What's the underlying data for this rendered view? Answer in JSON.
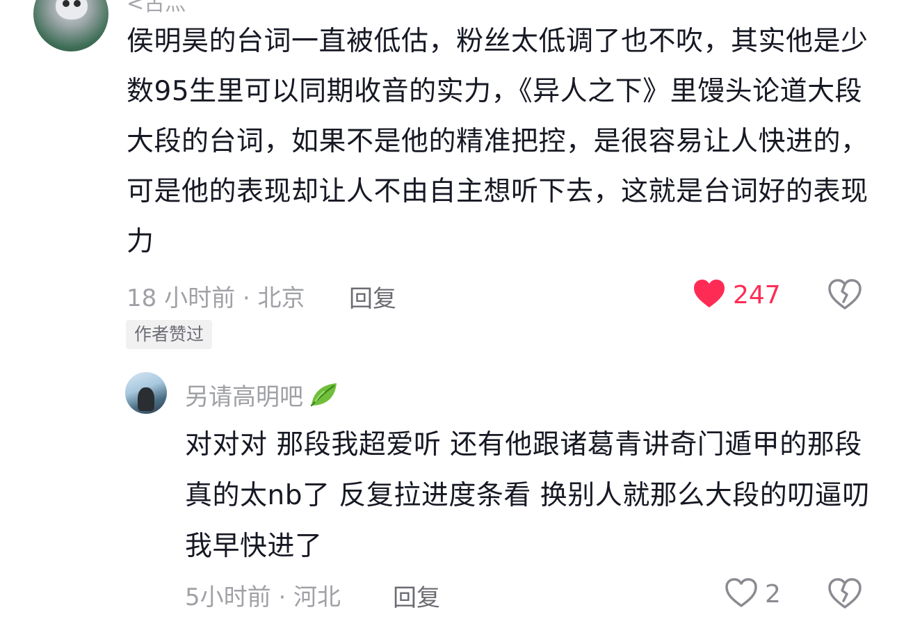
{
  "comment": {
    "username": "<古灬",
    "text": "侯明昊的台词一直被低估，粉丝太低调了也不吹，其实他是少数95生里可以同期收音的实力，《异人之下》里馒头论道大段大段的台词，如果不是他的精准把控，是很容易让人快进的，可是他的表现却让人不由自主想听下去，这就是台词好的表现力",
    "time_location": "18 小时前 · 北京",
    "reply_label": "回复",
    "author_liked_badge": "作者赞过",
    "like_count": "247",
    "like_icon": "heart-filled-icon",
    "dislike_icon": "broken-heart-icon",
    "liked": true
  },
  "reply": {
    "username": "另请高明吧",
    "username_emoji": "leaf-icon",
    "text": "对对对 那段我超爱听 还有他跟诸葛青讲奇门遁甲的那段 真的太nb了 反复拉进度条看 换别人就那么大段的叨逼叨我早快进了",
    "time_location": "5小时前 · 河北",
    "reply_label": "回复",
    "like_count": "2",
    "like_icon": "heart-outline-icon",
    "dislike_icon": "broken-heart-icon",
    "liked": false
  },
  "colors": {
    "like_active": "#fe2c55",
    "text_primary": "#161823",
    "text_secondary": "#a0a1a6",
    "icon_gray": "#8a8b91"
  }
}
